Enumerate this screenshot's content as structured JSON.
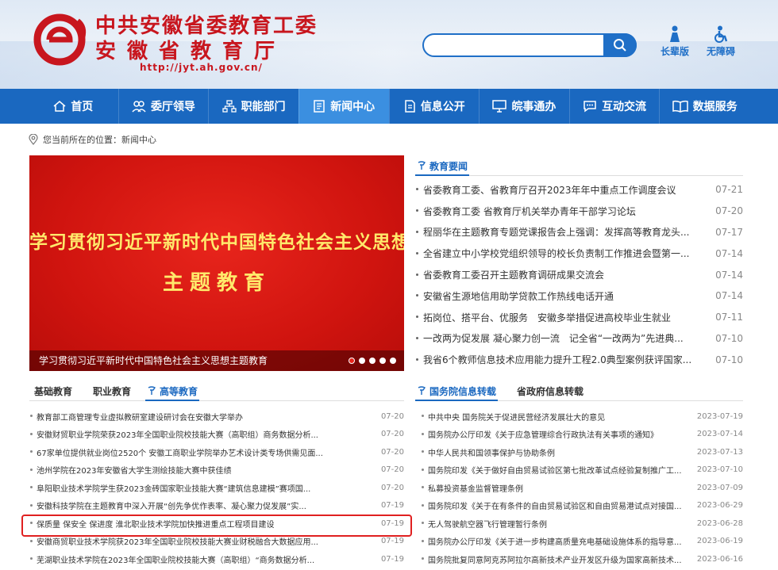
{
  "header": {
    "title_line1": "中共安徽省委教育工委",
    "title_line2": "安徽省教育厅",
    "url": "http://jyt.ah.gov.cn/",
    "search_placeholder": "",
    "tools": [
      {
        "label": "长辈版",
        "icon": "elder-icon"
      },
      {
        "label": "无障碍",
        "icon": "wheelchair-icon"
      }
    ]
  },
  "nav": [
    {
      "label": "首页",
      "icon": "home-icon"
    },
    {
      "label": "委厅领导",
      "icon": "users-icon"
    },
    {
      "label": "职能部门",
      "icon": "org-icon"
    },
    {
      "label": "新闻中心",
      "icon": "news-icon",
      "active": true
    },
    {
      "label": "信息公开",
      "icon": "doc-icon"
    },
    {
      "label": "皖事通办",
      "icon": "monitor-icon"
    },
    {
      "label": "互动交流",
      "icon": "chat-icon"
    },
    {
      "label": "数据服务",
      "icon": "book-icon"
    }
  ],
  "breadcrumb": "您当前所在的位置：新闻中心",
  "slide": {
    "line1": "学习贯彻习近平新时代中国特色社会主义思想",
    "line2": "主题教育",
    "caption": "学习贯彻习近平新时代中国特色社会主义思想主题教育"
  },
  "edu_news": {
    "tab": "教育要闻",
    "items": [
      {
        "title": "省委教育工委、省教育厅召开2023年年中重点工作调度会议",
        "date": "07-21"
      },
      {
        "title": "省委教育工委 省教育厅机关举办青年干部学习论坛",
        "date": "07-20"
      },
      {
        "title": "程丽华在主题教育专题党课报告会上强调：发挥高等教育龙头...",
        "date": "07-17"
      },
      {
        "title": "全省建立中小学校党组织领导的校长负责制工作推进会暨第一...",
        "date": "07-14"
      },
      {
        "title": "省委教育工委召开主题教育调研成果交流会",
        "date": "07-14"
      },
      {
        "title": "安徽省生源地信用助学贷款工作热线电话开通",
        "date": "07-14"
      },
      {
        "title": "拓岗位、搭平台、优服务　安徽多举措促进高校毕业生就业",
        "date": "07-11"
      },
      {
        "title": "一改两为促发展 凝心聚力创一流　记全省“一改两为”先进典...",
        "date": "07-10"
      },
      {
        "title": "我省6个教师信息技术应用能力提升工程2.0典型案例获评国家...",
        "date": "07-10"
      }
    ]
  },
  "edu_tabs": {
    "tab1": "基础教育",
    "tab2": "职业教育",
    "tab3": "高等教育",
    "items": [
      {
        "title": "教育部工商管理专业虚拟教研室建设研讨会在安徽大学举办",
        "date": "07-20"
      },
      {
        "title": "安徽财贸职业学院荣获2023年全国职业院校技能大赛（高职组）商务数据分析...",
        "date": "07-20"
      },
      {
        "title": "67家单位提供就业岗位2520个 安徽工商职业学院举办艺术设计类专场供需见面...",
        "date": "07-20"
      },
      {
        "title": "池州学院在2023年安徽省大学生测绘技能大赛中获佳绩",
        "date": "07-20"
      },
      {
        "title": "阜阳职业技术学院学生获2023金砖国家职业技能大赛“建筑信息建模”赛项国...",
        "date": "07-20"
      },
      {
        "title": "安徽科技学院在主题教育中深入开展“创先争优作表率、凝心聚力促发展”实...",
        "date": "07-19"
      },
      {
        "title": "保质量 保安全 保进度 淮北职业技术学院加快推进重点工程项目建设",
        "date": "07-19"
      },
      {
        "title": "安徽商贸职业技术学院获2023年全国职业院校技能大赛业财税融合大数据应用...",
        "date": "07-19"
      },
      {
        "title": "芜湖职业技术学院在2023年全国职业院校技能大赛（高职组）“商务数据分析...",
        "date": "07-19"
      }
    ]
  },
  "gov_info": {
    "tab1": "国务院信息转载",
    "tab2": "省政府信息转载",
    "items": [
      {
        "title": "中共中央 国务院关于促进民营经济发展壮大的意见",
        "date": "2023-07-19"
      },
      {
        "title": "国务院办公厅印发《关于应急管理综合行政执法有关事项的通知》",
        "date": "2023-07-14"
      },
      {
        "title": "中华人民共和国领事保护与协助条例",
        "date": "2023-07-13"
      },
      {
        "title": "国务院印发《关于做好自由贸易试验区第七批改革试点经验复制推广工...",
        "date": "2023-07-10"
      },
      {
        "title": "私募投资基金监督管理条例",
        "date": "2023-07-09"
      },
      {
        "title": "国务院印发《关于在有条件的自由贸易试验区和自由贸易港试点对接国...",
        "date": "2023-06-29"
      },
      {
        "title": "无人驾驶航空器飞行管理暂行条例",
        "date": "2023-06-28"
      },
      {
        "title": "国务院办公厅印发《关于进一步构建高质量充电基础设施体系的指导意...",
        "date": "2023-06-19"
      },
      {
        "title": "国务院批复同意阿克苏阿拉尔高新技术产业开发区升级为国家高新技术...",
        "date": "2023-06-16"
      }
    ]
  },
  "colors": {
    "brand_red": "#c8161e",
    "nav_blue": "#1a68c0",
    "highlight": "#e02020"
  }
}
